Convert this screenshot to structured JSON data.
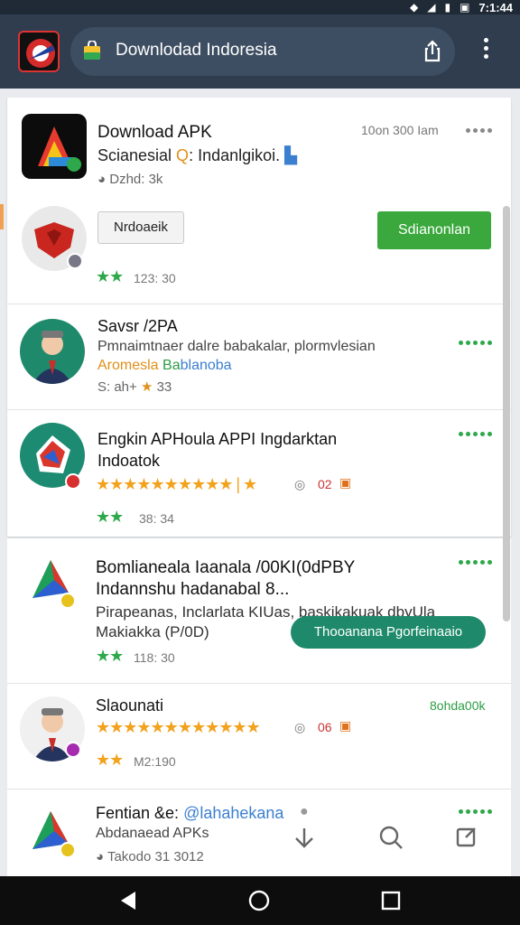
{
  "status": {
    "time": "7:1:44"
  },
  "browser": {
    "url": "Downlodad Indoresia"
  },
  "featured": {
    "title": "Download APK",
    "subtitle_main": "Scianesial ",
    "subtitle_tail": ": Indanlgikoi.",
    "meta": "Dzhd: 3k",
    "top_right": "10on 300 Iam",
    "outline_button": "Nrdoaeik",
    "green_button": "Sdianonlan",
    "rating_text": "123: 30"
  },
  "items": [
    {
      "title": "Savsr /2PA",
      "line2": "Pmnaimtnaer dalre babakalar, plormvlesian",
      "line3_orange": "Aromesla",
      "line3_green": "Ba",
      "line3_blue": "blanoba",
      "line4": "S: ah+",
      "rating": "33"
    },
    {
      "title": "Engkin APHoula APPI Ingdarktan",
      "title2": "Indoatok",
      "rating_count": "02",
      "rating_text": "38: 34"
    },
    {
      "title": "Bomlianeala Iaanala /00KI(0dPBY",
      "title2": "Indannshu hadanabal 8...",
      "line3": "Pirapeanas, Inclarlata KIUas, baskikakuak dbyUla",
      "line4": "Makiakka (P/0D)",
      "pill": "Thooanana Pgorfeinaaio",
      "rating_text": "118: 30"
    },
    {
      "title": "Slaounati",
      "green_label": "8ohda00k",
      "rating_count": "06",
      "rating_text": "M2:190"
    },
    {
      "title": "Fentian &e:",
      "title_blue": "@lahahekana",
      "subtitle": "Abdanaead APKs",
      "meta": "Takodo 31 3012"
    }
  ],
  "colors": {
    "toolbar": "#2f3d4f",
    "accent_green": "#3aa83c",
    "teal": "#1f8a6b",
    "star_orange": "#f2a21c"
  }
}
